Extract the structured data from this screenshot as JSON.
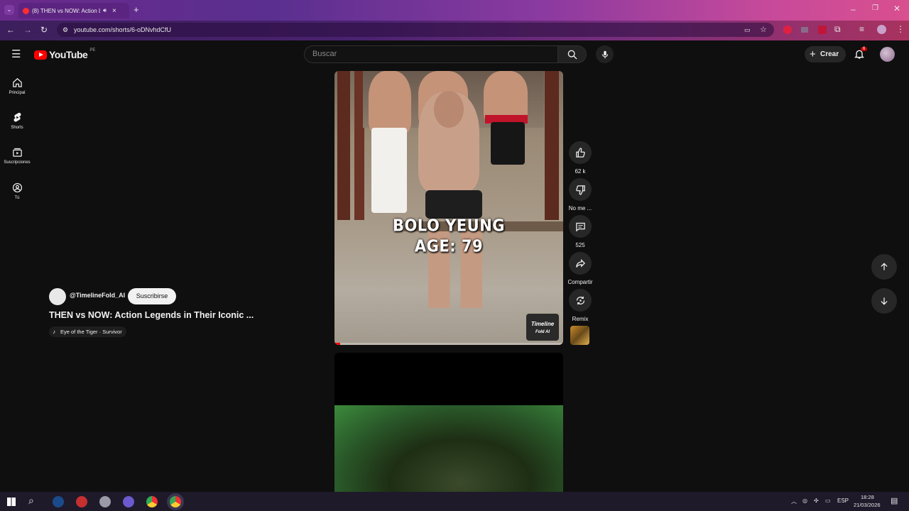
{
  "browser": {
    "tab_title": "(8) THEN vs NOW: Action Le",
    "url": "youtube.com/shorts/6-oDNvhdCfU"
  },
  "youtube": {
    "logo_text": "YouTube",
    "region_badge": "PE",
    "search_placeholder": "Buscar",
    "create_label": "Crear",
    "notification_count": "6"
  },
  "sidebar": {
    "items": [
      {
        "label": "Principal",
        "icon": "home-icon"
      },
      {
        "label": "Shorts",
        "icon": "shorts-icon"
      },
      {
        "label": "Suscripciones",
        "icon": "subscriptions-icon"
      },
      {
        "label": "Tú",
        "icon": "account-icon"
      }
    ]
  },
  "short": {
    "overlay_line1": "BOLO YEUNG",
    "overlay_line2": "AGE: 79",
    "watermark_line1": "Timeline",
    "watermark_line2": "Fold AI",
    "channel_handle": "@TimelineFold_AI",
    "subscribe_label": "Suscribirse",
    "title": "THEN vs NOW: Action Legends in Their Iconic ...",
    "music": "Eye of the Tiger · Survivor"
  },
  "actions": {
    "like_count": "62 k",
    "dislike_label": "No me ...",
    "comments_count": "525",
    "share_label": "Compartir",
    "remix_label": "Remix"
  },
  "taskbar": {
    "language": "ESP",
    "time": "18:28",
    "date": "21/03/2026"
  },
  "colors": {
    "background": "#0f0f0f",
    "youtube_red": "#ff0000",
    "chip": "#272727"
  }
}
